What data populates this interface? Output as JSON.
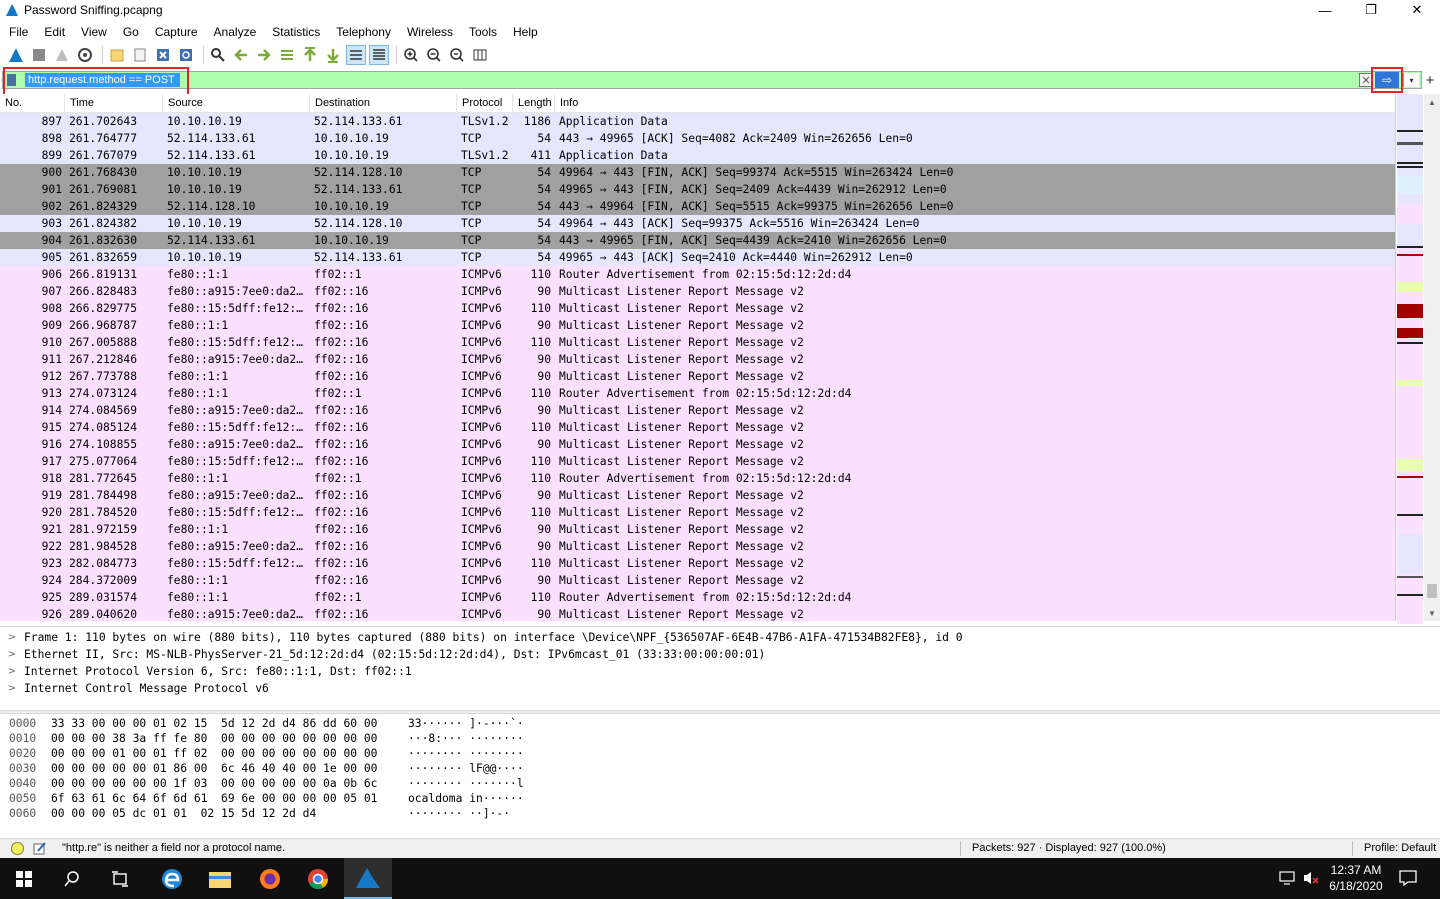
{
  "window": {
    "title": "Password Sniffing.pcapng",
    "controls": [
      "—",
      "❐",
      "✕"
    ]
  },
  "menu": [
    "File",
    "Edit",
    "View",
    "Go",
    "Capture",
    "Analyze",
    "Statistics",
    "Telephony",
    "Wireless",
    "Tools",
    "Help"
  ],
  "filter": {
    "value": "http.request.method == POST",
    "clear_glyph": "✕",
    "apply_glyph": "⇨",
    "dropdown_glyph": "▾",
    "add_glyph": "+"
  },
  "columns": [
    "No.",
    "Time",
    "Source",
    "Destination",
    "Protocol",
    "Length",
    "Info"
  ],
  "colors": {
    "tcp": "#e7e6ff",
    "fin": "#a0a0a0",
    "icmpv6": "#fce0ff",
    "filter_bg": "#afffaf",
    "highlight": "#e0262b"
  },
  "packets": [
    {
      "no": "897",
      "time": "261.702643",
      "src": "10.10.10.19",
      "dst": "52.114.133.61",
      "proto": "TLSv1.2",
      "len": "1186",
      "info": "Application Data",
      "c": "tcp"
    },
    {
      "no": "898",
      "time": "261.764777",
      "src": "52.114.133.61",
      "dst": "10.10.10.19",
      "proto": "TCP",
      "len": "54",
      "info": "443 → 49965 [ACK] Seq=4082 Ack=2409 Win=262656 Len=0",
      "c": "tcp"
    },
    {
      "no": "899",
      "time": "261.767079",
      "src": "52.114.133.61",
      "dst": "10.10.10.19",
      "proto": "TLSv1.2",
      "len": "411",
      "info": "Application Data",
      "c": "tcp"
    },
    {
      "no": "900",
      "time": "261.768430",
      "src": "10.10.10.19",
      "dst": "52.114.128.10",
      "proto": "TCP",
      "len": "54",
      "info": "49964 → 443 [FIN, ACK] Seq=99374 Ack=5515 Win=263424 Len=0",
      "c": "fin"
    },
    {
      "no": "901",
      "time": "261.769081",
      "src": "10.10.10.19",
      "dst": "52.114.133.61",
      "proto": "TCP",
      "len": "54",
      "info": "49965 → 443 [FIN, ACK] Seq=2409 Ack=4439 Win=262912 Len=0",
      "c": "fin"
    },
    {
      "no": "902",
      "time": "261.824329",
      "src": "52.114.128.10",
      "dst": "10.10.10.19",
      "proto": "TCP",
      "len": "54",
      "info": "443 → 49964 [FIN, ACK] Seq=5515 Ack=99375 Win=262656 Len=0",
      "c": "fin"
    },
    {
      "no": "903",
      "time": "261.824382",
      "src": "10.10.10.19",
      "dst": "52.114.128.10",
      "proto": "TCP",
      "len": "54",
      "info": "49964 → 443 [ACK] Seq=99375 Ack=5516 Win=263424 Len=0",
      "c": "tcp"
    },
    {
      "no": "904",
      "time": "261.832630",
      "src": "52.114.133.61",
      "dst": "10.10.10.19",
      "proto": "TCP",
      "len": "54",
      "info": "443 → 49965 [FIN, ACK] Seq=4439 Ack=2410 Win=262656 Len=0",
      "c": "fin"
    },
    {
      "no": "905",
      "time": "261.832659",
      "src": "10.10.10.19",
      "dst": "52.114.133.61",
      "proto": "TCP",
      "len": "54",
      "info": "49965 → 443 [ACK] Seq=2410 Ack=4440 Win=262912 Len=0",
      "c": "tcp"
    },
    {
      "no": "906",
      "time": "266.819131",
      "src": "fe80::1:1",
      "dst": "ff02::1",
      "proto": "ICMPv6",
      "len": "110",
      "info": "Router Advertisement from 02:15:5d:12:2d:d4",
      "c": "icmpv6"
    },
    {
      "no": "907",
      "time": "266.828483",
      "src": "fe80::a915:7ee0:da2…",
      "dst": "ff02::16",
      "proto": "ICMPv6",
      "len": "90",
      "info": "Multicast Listener Report Message v2",
      "c": "icmpv6"
    },
    {
      "no": "908",
      "time": "266.829775",
      "src": "fe80::15:5dff:fe12:…",
      "dst": "ff02::16",
      "proto": "ICMPv6",
      "len": "110",
      "info": "Multicast Listener Report Message v2",
      "c": "icmpv6"
    },
    {
      "no": "909",
      "time": "266.968787",
      "src": "fe80::1:1",
      "dst": "ff02::16",
      "proto": "ICMPv6",
      "len": "90",
      "info": "Multicast Listener Report Message v2",
      "c": "icmpv6"
    },
    {
      "no": "910",
      "time": "267.005888",
      "src": "fe80::15:5dff:fe12:…",
      "dst": "ff02::16",
      "proto": "ICMPv6",
      "len": "110",
      "info": "Multicast Listener Report Message v2",
      "c": "icmpv6"
    },
    {
      "no": "911",
      "time": "267.212846",
      "src": "fe80::a915:7ee0:da2…",
      "dst": "ff02::16",
      "proto": "ICMPv6",
      "len": "90",
      "info": "Multicast Listener Report Message v2",
      "c": "icmpv6"
    },
    {
      "no": "912",
      "time": "267.773788",
      "src": "fe80::1:1",
      "dst": "ff02::16",
      "proto": "ICMPv6",
      "len": "90",
      "info": "Multicast Listener Report Message v2",
      "c": "icmpv6"
    },
    {
      "no": "913",
      "time": "274.073124",
      "src": "fe80::1:1",
      "dst": "ff02::1",
      "proto": "ICMPv6",
      "len": "110",
      "info": "Router Advertisement from 02:15:5d:12:2d:d4",
      "c": "icmpv6"
    },
    {
      "no": "914",
      "time": "274.084569",
      "src": "fe80::a915:7ee0:da2…",
      "dst": "ff02::16",
      "proto": "ICMPv6",
      "len": "90",
      "info": "Multicast Listener Report Message v2",
      "c": "icmpv6"
    },
    {
      "no": "915",
      "time": "274.085124",
      "src": "fe80::15:5dff:fe12:…",
      "dst": "ff02::16",
      "proto": "ICMPv6",
      "len": "110",
      "info": "Multicast Listener Report Message v2",
      "c": "icmpv6"
    },
    {
      "no": "916",
      "time": "274.108855",
      "src": "fe80::a915:7ee0:da2…",
      "dst": "ff02::16",
      "proto": "ICMPv6",
      "len": "90",
      "info": "Multicast Listener Report Message v2",
      "c": "icmpv6"
    },
    {
      "no": "917",
      "time": "275.077064",
      "src": "fe80::15:5dff:fe12:…",
      "dst": "ff02::16",
      "proto": "ICMPv6",
      "len": "110",
      "info": "Multicast Listener Report Message v2",
      "c": "icmpv6"
    },
    {
      "no": "918",
      "time": "281.772645",
      "src": "fe80::1:1",
      "dst": "ff02::1",
      "proto": "ICMPv6",
      "len": "110",
      "info": "Router Advertisement from 02:15:5d:12:2d:d4",
      "c": "icmpv6"
    },
    {
      "no": "919",
      "time": "281.784498",
      "src": "fe80::a915:7ee0:da2…",
      "dst": "ff02::16",
      "proto": "ICMPv6",
      "len": "90",
      "info": "Multicast Listener Report Message v2",
      "c": "icmpv6"
    },
    {
      "no": "920",
      "time": "281.784520",
      "src": "fe80::15:5dff:fe12:…",
      "dst": "ff02::16",
      "proto": "ICMPv6",
      "len": "110",
      "info": "Multicast Listener Report Message v2",
      "c": "icmpv6"
    },
    {
      "no": "921",
      "time": "281.972159",
      "src": "fe80::1:1",
      "dst": "ff02::16",
      "proto": "ICMPv6",
      "len": "90",
      "info": "Multicast Listener Report Message v2",
      "c": "icmpv6"
    },
    {
      "no": "922",
      "time": "281.984528",
      "src": "fe80::a915:7ee0:da2…",
      "dst": "ff02::16",
      "proto": "ICMPv6",
      "len": "90",
      "info": "Multicast Listener Report Message v2",
      "c": "icmpv6"
    },
    {
      "no": "923",
      "time": "282.084773",
      "src": "fe80::15:5dff:fe12:…",
      "dst": "ff02::16",
      "proto": "ICMPv6",
      "len": "110",
      "info": "Multicast Listener Report Message v2",
      "c": "icmpv6"
    },
    {
      "no": "924",
      "time": "284.372009",
      "src": "fe80::1:1",
      "dst": "ff02::16",
      "proto": "ICMPv6",
      "len": "90",
      "info": "Multicast Listener Report Message v2",
      "c": "icmpv6"
    },
    {
      "no": "925",
      "time": "289.031574",
      "src": "fe80::1:1",
      "dst": "ff02::1",
      "proto": "ICMPv6",
      "len": "110",
      "info": "Router Advertisement from 02:15:5d:12:2d:d4",
      "c": "icmpv6"
    },
    {
      "no": "926",
      "time": "289.040620",
      "src": "fe80::a915:7ee0:da2…",
      "dst": "ff02::16",
      "proto": "ICMPv6",
      "len": "90",
      "info": "Multicast Listener Report Message v2",
      "c": "icmpv6"
    }
  ],
  "details": [
    "Frame 1: 110 bytes on wire (880 bits), 110 bytes captured (880 bits) on interface \\Device\\NPF_{536507AF-6E4B-47B6-A1FA-471534B82FE8}, id 0",
    "Ethernet II, Src: MS-NLB-PhysServer-21_5d:12:2d:d4 (02:15:5d:12:2d:d4), Dst: IPv6mcast_01 (33:33:00:00:00:01)",
    "Internet Protocol Version 6, Src: fe80::1:1, Dst: ff02::1",
    "Internet Control Message Protocol v6"
  ],
  "bytes": [
    {
      "off": "0000",
      "hex": "33 33 00 00 00 01 02 15  5d 12 2d d4 86 dd 60 00",
      "asc": "33······ ]·-···`·"
    },
    {
      "off": "0010",
      "hex": "00 00 00 38 3a ff fe 80  00 00 00 00 00 00 00 00",
      "asc": "···8:··· ········"
    },
    {
      "off": "0020",
      "hex": "00 00 00 01 00 01 ff 02  00 00 00 00 00 00 00 00",
      "asc": "········ ········"
    },
    {
      "off": "0030",
      "hex": "00 00 00 00 00 01 86 00  6c 46 40 40 00 1e 00 00",
      "asc": "········ lF@@····"
    },
    {
      "off": "0040",
      "hex": "00 00 00 00 00 00 1f 03  00 00 00 00 00 0a 0b 6c",
      "asc": "········ ·······l"
    },
    {
      "off": "0050",
      "hex": "6f 63 61 6c 64 6f 6d 61  69 6e 00 00 00 00 05 01",
      "asc": "ocaldoma in······"
    },
    {
      "off": "0060",
      "hex": "00 00 00 05 dc 01 01  02 15 5d 12 2d d4",
      "asc": "········ ··]·-·"
    }
  ],
  "status": {
    "message": "\"http.re\" is neither a field nor a protocol name.",
    "packets": "Packets: 927 · Displayed: 927 (100.0%)",
    "profile": "Profile: Default"
  },
  "taskbar": {
    "time": "12:37 AM",
    "date": "6/18/2020"
  }
}
